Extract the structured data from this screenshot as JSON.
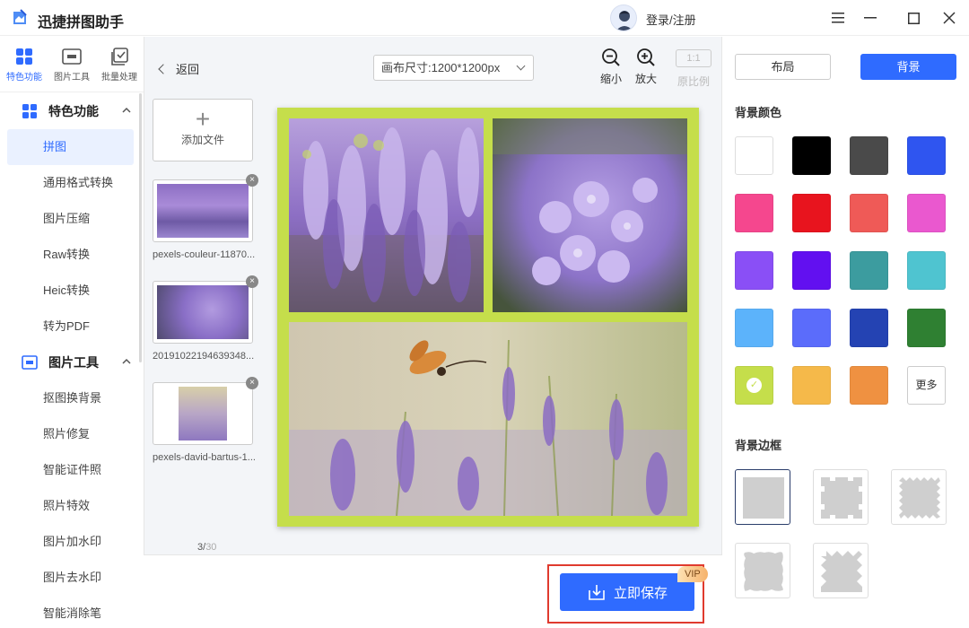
{
  "app": {
    "title": "迅捷拼图助手",
    "login_label": "登录/注册"
  },
  "left_tabs": [
    {
      "label": "特色功能",
      "icon": "grid-icon"
    },
    {
      "label": "图片工具",
      "icon": "image-tool-icon"
    },
    {
      "label": "批量处理",
      "icon": "batch-icon"
    }
  ],
  "sidebar": {
    "group1": {
      "label": "特色功能"
    },
    "group1_items": [
      "拼图",
      "通用格式转换",
      "图片压缩",
      "Raw转换",
      "Heic转换",
      "转为PDF"
    ],
    "group2": {
      "label": "图片工具"
    },
    "group2_items": [
      "抠图换背景",
      "照片修复",
      "智能证件照",
      "照片特效",
      "图片加水印",
      "图片去水印",
      "智能消除笔"
    ]
  },
  "toolbar": {
    "back_label": "返回",
    "canvas_size": "画布尺寸:1200*1200px",
    "zoom_out": "缩小",
    "zoom_in": "放大",
    "ratio_box": "1:1",
    "ratio_label": "原比例"
  },
  "files": {
    "add_label": "添加文件",
    "items": [
      {
        "name": "pexels-couleur-11870..."
      },
      {
        "name": "20191022194639348..."
      },
      {
        "name": "pexels-david-bartus-1..."
      }
    ],
    "count_current": "3/",
    "count_total": "30"
  },
  "save": {
    "label": "立即保存",
    "vip": "VIP"
  },
  "right_panel": {
    "tab_layout": "布局",
    "tab_background": "背景",
    "bg_color_title": "背景颜色",
    "more_label": "更多",
    "border_title": "背景边框",
    "selected_color": "#c5de4b",
    "colors": [
      "#ffffff",
      "#000000",
      "#4a4a4a",
      "#2f55f0",
      "#f5478e",
      "#e8141e",
      "#ef5a57",
      "#ea58cf",
      "#8a4ff6",
      "#6210f0",
      "#3c9c9f",
      "#4fc4d0",
      "#5cb3fb",
      "#5b6cfb",
      "#2443b3",
      "#2f8032",
      "#c5de4b",
      "#f5b94a",
      "#ef9141"
    ]
  }
}
